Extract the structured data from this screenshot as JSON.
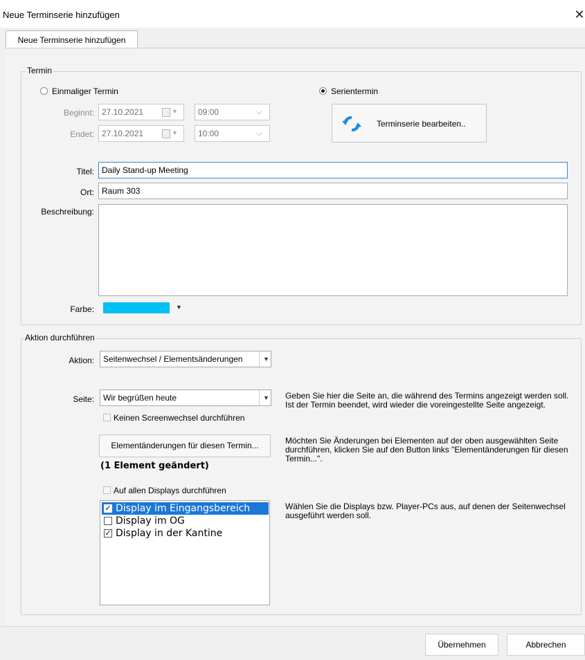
{
  "window": {
    "title": "Neue Terminserie hinzufügen",
    "close_glyph": "✕"
  },
  "tab": {
    "label": "Neue Terminserie hinzufügen"
  },
  "termin": {
    "legend": "Termin",
    "single_label": "Einmaliger Termin",
    "series_label": "Serientermin",
    "begins_label": "Beginnt:",
    "begins_date": "27.10.2021",
    "begins_time": "09:00",
    "ends_label": "Endet:",
    "ends_date": "27.10.2021",
    "ends_time": "10:00",
    "edit_series_button": "Terminserie bearbeiten..",
    "title_label": "Titel:",
    "title_value": "Daily Stand-up Meeting",
    "location_label": "Ort:",
    "location_value": "Raum 303",
    "description_label": "Beschreibung:",
    "description_value": "",
    "color_label": "Farbe:",
    "color_value": "#00bff3"
  },
  "action": {
    "legend": "Aktion durchführen",
    "action_label": "Aktion:",
    "action_value": "Seitenwechsel / Elementsänderungen",
    "page_label": "Seite:",
    "page_value": "Wir begrüßen heute",
    "no_screenchange_label": "Keinen Screenwechsel durchführen",
    "page_help": "Geben Sie hier die Seite an, die während des Termins angezeigt werden soll. Ist der Termin beendet, wird wieder die voreingestellte Seite angezeigt.",
    "element_changes_button": "Elementänderungen für diesen Termin...",
    "element_changed_text": "(1 Element geändert)",
    "element_help": "Möchten Sie Änderungen bei Elementen auf der oben ausgewählten Seite durchführen, klicken Sie auf den Button links \"Elementänderungen für diesen Termin...\".",
    "all_displays_label": "Auf allen Displays durchführen",
    "displays": [
      {
        "label": "Display im Eingangsbereich",
        "checked": true,
        "selected": true
      },
      {
        "label": "Display im OG",
        "checked": false,
        "selected": false
      },
      {
        "label": "Display in der Kantine",
        "checked": true,
        "selected": false
      }
    ],
    "displays_help": "Wählen Sie die Displays bzw. Player-PCs aus, auf denen der Seitenwechsel ausgeführt werden soll."
  },
  "footer": {
    "apply_button": "Übernehmen",
    "cancel_button": "Abbrechen"
  }
}
